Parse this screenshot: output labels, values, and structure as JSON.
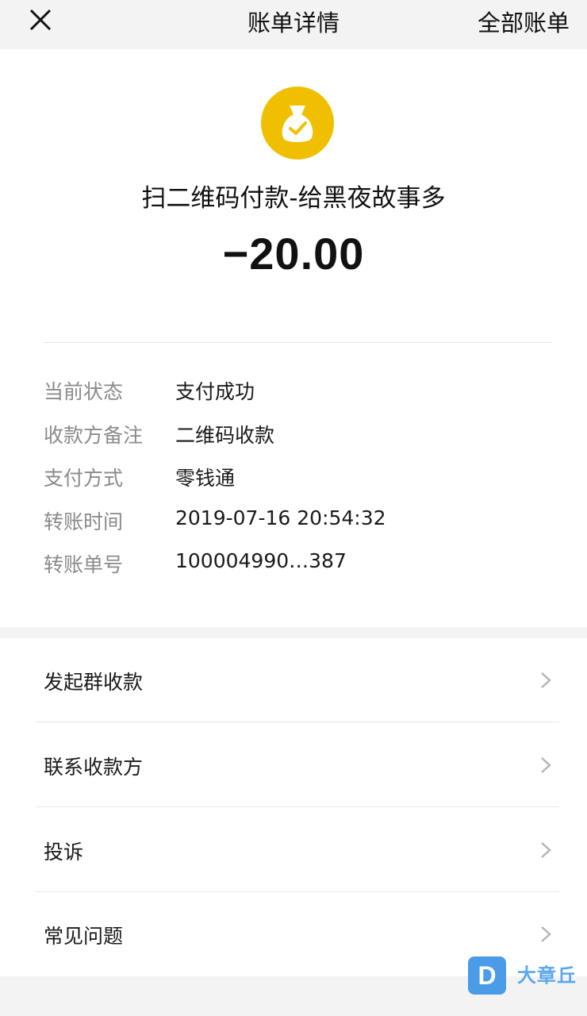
{
  "header": {
    "title": "账单详情",
    "all_bills_label": "全部账单",
    "close_icon": "close-icon"
  },
  "transaction": {
    "icon": "money-bag-check-icon",
    "icon_color": "#f0c000",
    "merchant": "扫二维码付款-给黑夜故事多",
    "amount": "−20.00"
  },
  "details": [
    {
      "label": "当前状态",
      "value": "支付成功"
    },
    {
      "label": "收款方备注",
      "value": "二维码收款"
    },
    {
      "label": "支付方式",
      "value": "零钱通"
    },
    {
      "label": "转账时间",
      "value": "2019-07-16 20:54:32"
    },
    {
      "label": "转账单号",
      "value": "100004990…387"
    }
  ],
  "menu": [
    {
      "label": "发起群收款"
    },
    {
      "label": "联系收款方"
    },
    {
      "label": "投诉"
    },
    {
      "label": "常见问题"
    }
  ],
  "watermark": {
    "logo_letter": "D",
    "text": "大章丘"
  }
}
